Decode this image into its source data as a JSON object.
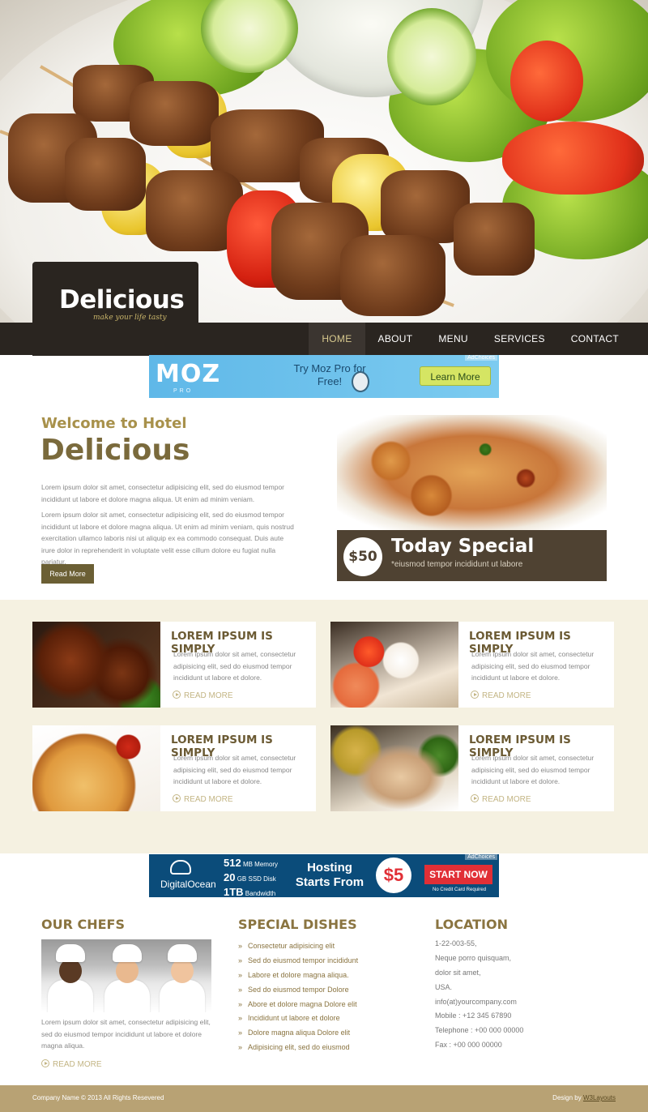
{
  "logo": {
    "title": "Delicious",
    "tagline": "make your life tasty"
  },
  "nav": {
    "items": [
      {
        "label": "HOME",
        "active": true
      },
      {
        "label": "ABOUT",
        "active": false
      },
      {
        "label": "MENU",
        "active": false
      },
      {
        "label": "SERVICES",
        "active": false
      },
      {
        "label": "CONTACT",
        "active": false
      }
    ]
  },
  "ad_moz": {
    "badge": "AdChoices",
    "logo": "MOZ",
    "sub": "PRO",
    "text": "Try Moz Pro for Free!",
    "button": "Learn More",
    "bg_color": "#6cc0ec"
  },
  "welcome": {
    "subtitle": "Welcome to Hotel",
    "title": "Delicious",
    "p1": "Lorem ipsum dolor sit amet, consectetur adipisicing elit, sed do eiusmod tempor incididunt ut labore et dolore magna aliqua. Ut enim ad minim veniam.",
    "p2": "Lorem ipsum dolor sit amet, consectetur adipisicing elit, sed do eiusmod tempor incididunt ut labore et dolore magna aliqua. Ut enim ad minim veniam, quis nostrud exercitation ullamco laboris nisi ut aliquip ex ea commodo consequat. Duis aute irure dolor in reprehenderit in voluptate velit esse cillum dolore eu fugiat nulla pariatur.",
    "button": "Read More"
  },
  "special": {
    "price": "$50",
    "title": "Today Special",
    "subtitle": "*eiusmod tempor incididunt ut labore"
  },
  "cards": [
    {
      "title": "LOREM IPSUM IS SIMPLY",
      "text": "Lorem ipsum dolor sit amet, consectetur adipisicing elit, sed do eiusmod tempor incididunt ut labore et dolore.",
      "more": "READ MORE",
      "image": "ribs"
    },
    {
      "title": "LOREM IPSUM IS SIMPLY",
      "text": "Lorem ipsum dolor sit amet, consectetur adipisicing elit, sed do eiusmod tempor incididunt ut labore et dolore.",
      "more": "READ MORE",
      "image": "sushi"
    },
    {
      "title": "LOREM IPSUM IS SIMPLY",
      "text": "Lorem ipsum dolor sit amet, consectetur adipisicing elit, sed do eiusmod tempor incididunt ut labore et dolore.",
      "more": "READ MORE",
      "image": "pizza"
    },
    {
      "title": "LOREM IPSUM IS SIMPLY",
      "text": "Lorem ipsum dolor sit amet, consectetur adipisicing elit, sed do eiusmod tempor incididunt ut labore et dolore.",
      "more": "READ MORE",
      "image": "chicken"
    }
  ],
  "ad_do": {
    "badge": "AdChoices",
    "logo": "DigitalOcean",
    "specs": [
      {
        "value": "512",
        "label": "MB Memory"
      },
      {
        "value": "20",
        "label": "GB SSD Disk"
      },
      {
        "value": "1TB",
        "label": "Bandwidth"
      }
    ],
    "headline": "Hosting Starts From",
    "price": "$5",
    "button": "START NOW",
    "note": "No Credit Card Required"
  },
  "chefs": {
    "title": "OUR CHEFS",
    "text": "Lorem ipsum dolor sit amet, consectetur adipisicing elit, sed do eiusmod tempor incididunt ut labore et dolore magna aliqua.",
    "more": "READ MORE"
  },
  "dishes": {
    "title": "SPECIAL DISHES",
    "items": [
      "Consectetur adipisicing elit",
      "Sed do eiusmod tempor incididunt",
      "Labore et dolore magna aliqua.",
      "Sed do eiusmod tempor Dolore",
      "Abore et dolore magna Dolore elit",
      "Incididunt ut labore et dolore",
      "Dolore magna aliqua Dolore elit",
      "Adipisicing elit, sed do eiusmod"
    ]
  },
  "location": {
    "title": "LOCATION",
    "lines": [
      "1-22-003-55,",
      "Neque porro quisquam,",
      "dolor sit amet,",
      "USA.",
      "info(at)yourcompany.com",
      "Mobile : +12 345 67890",
      "Telephone : +00 000 00000",
      "Fax : +00 000 00000"
    ]
  },
  "footer": {
    "copyright": "Company Name © 2013 All Rights Resevered",
    "design_prefix": "Design by ",
    "design_link": "W3Layouts"
  },
  "colors": {
    "accent": "#a8914b",
    "dark": "#2a2520",
    "band": "#f5f1e1",
    "footer": "#b8a274"
  }
}
